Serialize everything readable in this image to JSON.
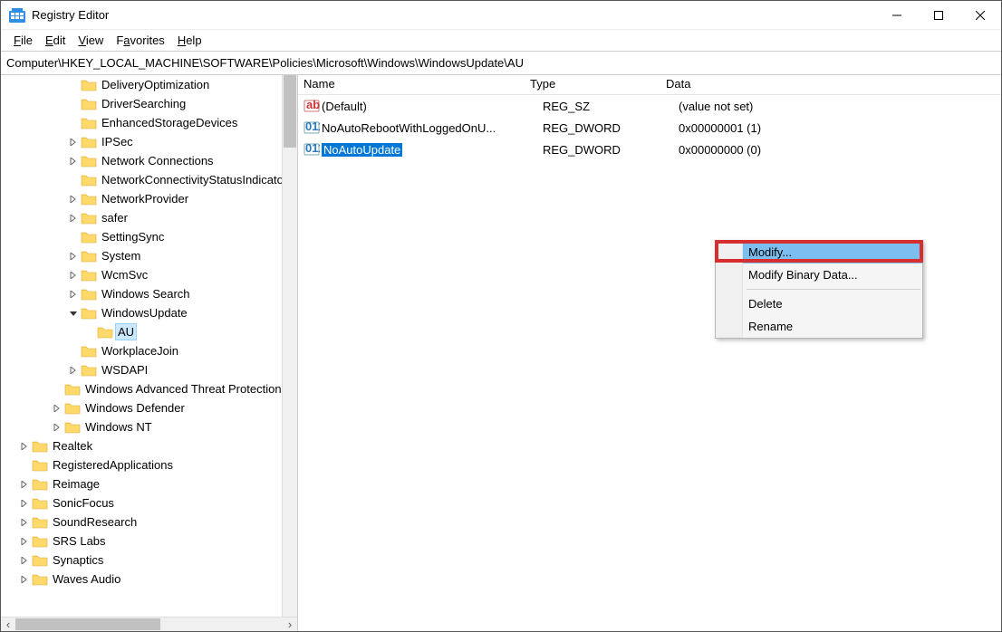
{
  "window": {
    "title": "Registry Editor"
  },
  "menu": {
    "file": "File",
    "edit": "Edit",
    "view": "View",
    "favorites": "Favorites",
    "help": "Help"
  },
  "address": "Computer\\HKEY_LOCAL_MACHINE\\SOFTWARE\\Policies\\Microsoft\\Windows\\WindowsUpdate\\AU",
  "tree": {
    "items": [
      {
        "indent": 4,
        "exp": "",
        "label": "DeliveryOptimization"
      },
      {
        "indent": 4,
        "exp": "",
        "label": "DriverSearching"
      },
      {
        "indent": 4,
        "exp": "",
        "label": "EnhancedStorageDevices"
      },
      {
        "indent": 4,
        "exp": ">",
        "label": "IPSec"
      },
      {
        "indent": 4,
        "exp": ">",
        "label": "Network Connections"
      },
      {
        "indent": 4,
        "exp": "",
        "label": "NetworkConnectivityStatusIndicator"
      },
      {
        "indent": 4,
        "exp": ">",
        "label": "NetworkProvider"
      },
      {
        "indent": 4,
        "exp": ">",
        "label": "safer"
      },
      {
        "indent": 4,
        "exp": "",
        "label": "SettingSync"
      },
      {
        "indent": 4,
        "exp": ">",
        "label": "System"
      },
      {
        "indent": 4,
        "exp": ">",
        "label": "WcmSvc"
      },
      {
        "indent": 4,
        "exp": ">",
        "label": "Windows Search"
      },
      {
        "indent": 4,
        "exp": "v",
        "label": "WindowsUpdate"
      },
      {
        "indent": 5,
        "exp": "",
        "label": "AU",
        "selected": true
      },
      {
        "indent": 4,
        "exp": "",
        "label": "WorkplaceJoin"
      },
      {
        "indent": 4,
        "exp": ">",
        "label": "WSDAPI"
      },
      {
        "indent": 3,
        "exp": "",
        "label": "Windows Advanced Threat Protection"
      },
      {
        "indent": 3,
        "exp": ">",
        "label": "Windows Defender"
      },
      {
        "indent": 3,
        "exp": ">",
        "label": "Windows NT"
      },
      {
        "indent": 1,
        "exp": ">",
        "label": "Realtek"
      },
      {
        "indent": 1,
        "exp": "",
        "label": "RegisteredApplications"
      },
      {
        "indent": 1,
        "exp": ">",
        "label": "Reimage"
      },
      {
        "indent": 1,
        "exp": ">",
        "label": "SonicFocus"
      },
      {
        "indent": 1,
        "exp": ">",
        "label": "SoundResearch"
      },
      {
        "indent": 1,
        "exp": ">",
        "label": "SRS Labs"
      },
      {
        "indent": 1,
        "exp": ">",
        "label": "Synaptics"
      },
      {
        "indent": 1,
        "exp": ">",
        "label": "Waves Audio"
      }
    ]
  },
  "list": {
    "columns": {
      "name": "Name",
      "type": "Type",
      "data": "Data"
    },
    "rows": [
      {
        "icon": "ab",
        "name": "(Default)",
        "type": "REG_SZ",
        "data": "(value not set)"
      },
      {
        "icon": "011",
        "name": "NoAutoRebootWithLoggedOnU...",
        "type": "REG_DWORD",
        "data": "0x00000001 (1)"
      },
      {
        "icon": "011",
        "name": "NoAutoUpdate",
        "type": "REG_DWORD",
        "data": "0x00000000 (0)",
        "selected": true
      }
    ]
  },
  "ctx": {
    "modify": "Modify...",
    "modify_bin": "Modify Binary Data...",
    "delete": "Delete",
    "rename": "Rename"
  }
}
